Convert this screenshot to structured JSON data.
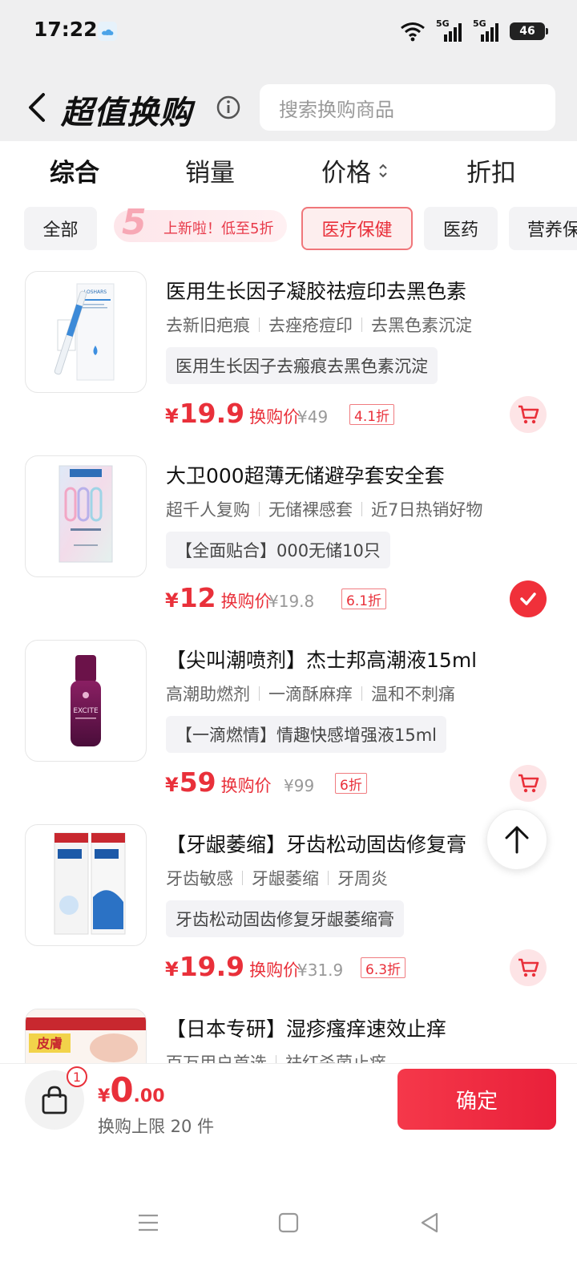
{
  "status_bar": {
    "time": "17:22",
    "net1": "5G",
    "net2": "5G",
    "battery": "46"
  },
  "header": {
    "back_icon": "chevron-left-icon",
    "title": "超值换购",
    "search_placeholder": "搜索换购商品"
  },
  "sort_tabs": [
    {
      "label": "综合",
      "active": true
    },
    {
      "label": "销量",
      "active": false
    },
    {
      "label": "价格",
      "active": false
    },
    {
      "label": "折扣",
      "active": false
    }
  ],
  "categories": [
    {
      "label": "全部"
    },
    {
      "label": "医疗保健",
      "active": true
    },
    {
      "label": "医药"
    },
    {
      "label": "营养保"
    }
  ],
  "promo": {
    "badge": "5",
    "text": "上新啦！低至5折"
  },
  "products": [
    {
      "title": "医用生长因子凝胶祛痘印去黑色素",
      "tags": [
        "去新旧疤痕",
        "去痤疮痘印",
        "去黑色素沉淀"
      ],
      "pill": "医用生长因子去瘢痕去黑色素沉淀",
      "yen": "¥",
      "price": "19.9",
      "price_label": "换购价",
      "orig": "¥49",
      "discount": "4.1折",
      "action": "cart-icon"
    },
    {
      "title": "大卫000超薄无储避孕套安全套",
      "tags": [
        "超千人复购",
        "无储裸感套",
        "近7日热销好物"
      ],
      "pill": "【全面贴合】000无储10只",
      "yen": "¥",
      "price": "12",
      "price_label": "换购价",
      "orig": "¥19.8",
      "discount": "6.1折",
      "action": "check-icon"
    },
    {
      "title": "【尖叫潮喷剂】杰士邦高潮液15ml",
      "tags": [
        "高潮助燃剂",
        "一滴酥麻痒",
        "温和不刺痛"
      ],
      "pill": "【一滴燃情】情趣快感增强液15ml",
      "yen": "¥",
      "price": "59",
      "price_label": "换购价",
      "orig": "¥99",
      "discount": "6折",
      "action": "cart-icon"
    },
    {
      "title": "【牙龈萎缩】牙齿松动固齿修复膏",
      "tags": [
        "牙齿敏感",
        "牙龈萎缩",
        "牙周炎"
      ],
      "pill": "牙齿松动固齿修复牙龈萎缩膏",
      "yen": "¥",
      "price": "19.9",
      "price_label": "换购价",
      "orig": "¥31.9",
      "discount": "6.3折",
      "action": "cart-icon"
    },
    {
      "title": "【日本专研】湿疹瘙痒速效止痒",
      "tags": [
        "百万用户首选",
        "祛红杀菌止痒"
      ]
    }
  ],
  "product_images": {
    "p1_brand": "LOSHARS",
    "p3_brand": "EXCITE",
    "p5_box": "皮膚"
  },
  "bottom_bar": {
    "badge": "1",
    "yen": "¥",
    "total_int": "0",
    "total_dec": ".00",
    "limit": "换购上限 20 件",
    "confirm": "确定"
  },
  "colors": {
    "accent": "#e9303a",
    "background": "#efeff0"
  }
}
